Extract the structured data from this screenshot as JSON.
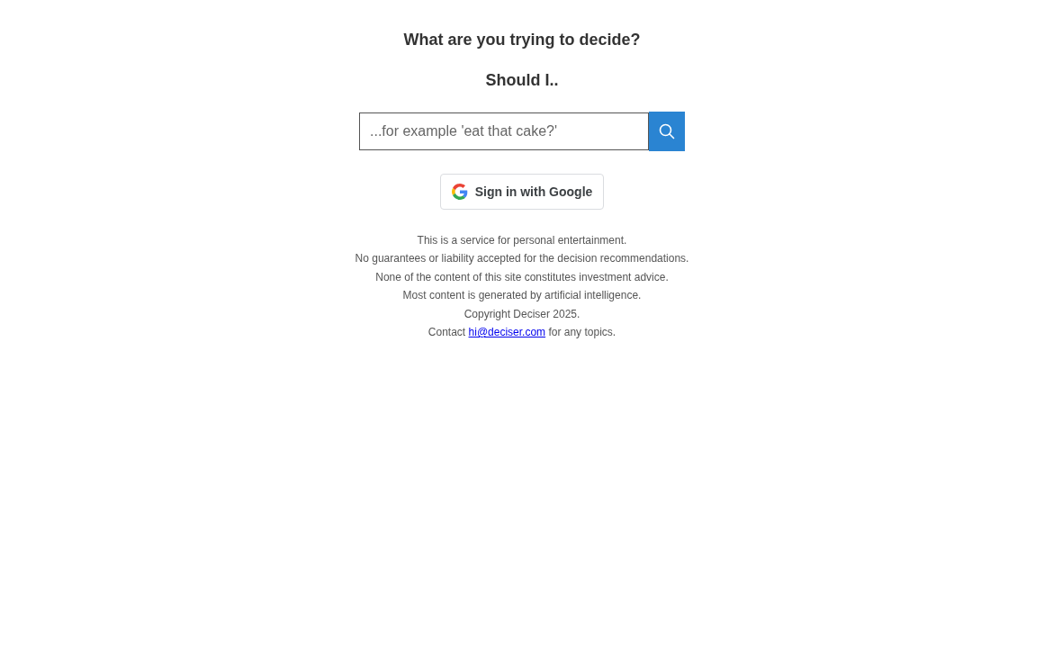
{
  "title": "What are you trying to decide?",
  "subtitle": "Should I..",
  "search": {
    "placeholder": "...for example 'eat that cake?'"
  },
  "google_button": {
    "label": "Sign in with Google"
  },
  "disclaimer": [
    "This is a service for personal entertainment.",
    "No guarantees or liability accepted for the decision recommendations.",
    "None of the content of this site constitutes investment advice.",
    "Most content is generated by artificial intelligence.",
    "Copyright Deciser 2025."
  ],
  "contact": {
    "before": "Contact",
    "link": "hi@deciser.com",
    "after": "for any topics."
  }
}
